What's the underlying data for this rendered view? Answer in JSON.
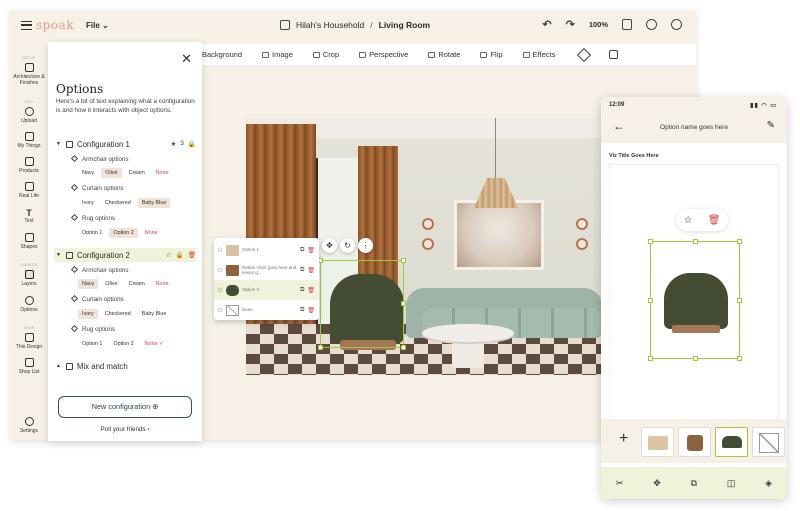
{
  "app": {
    "logo": "spoak",
    "file_menu": "File",
    "breadcrumb": {
      "household": "Hilah's Household",
      "separator": "/",
      "room": "Living Room"
    },
    "zoom": "100%"
  },
  "toolbar": {
    "items": [
      "Background",
      "Image",
      "Crop",
      "Perspective",
      "Rotate",
      "Flip",
      "Effects"
    ]
  },
  "leftnav": {
    "sections": {
      "setup": "SETUP",
      "add": "ADD",
      "manage": "MANAGE",
      "shop": "SHOP"
    },
    "items": {
      "architecture": "Architecture & Finishes",
      "upload": "Upload",
      "my_things": "My Things",
      "products": "Products",
      "real_life": "Real Life",
      "text": "Text",
      "shapes": "Shapes",
      "layers": "Layers",
      "options": "Options",
      "this_design": "This Design",
      "shop_list": "Shop List",
      "settings": "Settings"
    }
  },
  "options_panel": {
    "title": "Options",
    "description": "Here's a bit of text explaining what a configuration is and how it interacts with object options.",
    "configurations": [
      {
        "name": "Configuration 1",
        "star_count": "3",
        "groups": [
          {
            "label": "Armchair options",
            "chips": [
              "Navy",
              "Olive",
              "Cream",
              "None"
            ],
            "selected": 1
          },
          {
            "label": "Curtain options",
            "chips": [
              "Ivory",
              "Checkered",
              "Baby Blue"
            ],
            "selected": 2
          },
          {
            "label": "Rug options",
            "chips": [
              "Option 1",
              "Option 2",
              "None"
            ],
            "selected": 1
          }
        ]
      },
      {
        "name": "Configuration 2",
        "groups": [
          {
            "label": "Armchair options",
            "chips": [
              "Navy",
              "Olive",
              "Cream",
              "None"
            ],
            "selected": 0
          },
          {
            "label": "Curtain options",
            "chips": [
              "Ivory",
              "Checkered",
              "Baby Blue"
            ],
            "selected": 0
          },
          {
            "label": "Rug options",
            "chips": [
              "Option 1",
              "Option 2",
              "None ✓"
            ],
            "selected": 2
          }
        ]
      }
    ],
    "mix_and_match": "Mix and match",
    "new_config_button": "New configuration ⊕",
    "poll_link": "Poll your friends ›"
  },
  "popover": {
    "rows": [
      {
        "label": "Option 1"
      },
      {
        "label": "Rattan chair goes here and keeps g..."
      },
      {
        "label": "Option 3"
      },
      {
        "label": "None"
      }
    ]
  },
  "phone": {
    "time": "12:09",
    "title": "Option name goes here",
    "subtitle": "Viz Title Goes Here"
  },
  "colors": {
    "accent_green": "#9ccc3c",
    "highlight_green": "#eef3d9",
    "cream_bg": "#f6f0e6",
    "none_red": "#d04444",
    "chip_selected": "#f0e2d6",
    "brand_coral": "#e0a08c"
  }
}
